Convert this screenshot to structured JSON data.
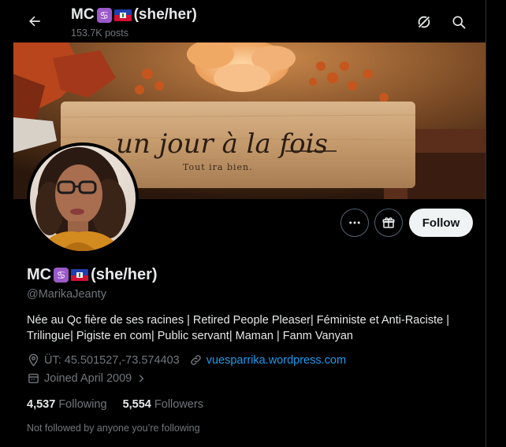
{
  "header": {
    "name": "MC",
    "pronouns": "(she/her)",
    "posts_count": "153.7K posts"
  },
  "profile": {
    "name": "MC",
    "pronouns": "(she/her)",
    "zodiac_emoji": "♋",
    "flag_emoji": "haiti-flag",
    "handle": "@MarikaJeanty",
    "bio": "Née au Qc fière de ses racines | Retired People Pleaser| Féministe et Anti-Raciste | Trilingue| Pigiste en com| Public servant| Maman | Fanm Vanyan",
    "location": "ÜT: 45.501527,-73.574403",
    "website": "vuesparrika.wordpress.com",
    "joined": "Joined April 2009",
    "following_count": "4,537",
    "following_label": "Following",
    "followers_count": "5,554",
    "followers_label": "Followers",
    "not_followed_text": "Not followed by anyone you’re following"
  },
  "banner": {
    "script_text": "un jour à la fois",
    "small_text": "Tout ira bien."
  },
  "buttons": {
    "follow_label": "Follow"
  },
  "icons": {
    "back": "arrow-left-icon",
    "grok": "grok-icon",
    "search": "search-icon",
    "more": "more-dots-icon",
    "subscribe": "gift-icon",
    "location": "location-pin-icon",
    "link": "link-icon",
    "calendar": "calendar-icon",
    "chevron": "chevron-right-icon"
  },
  "colors": {
    "background": "#000000",
    "text_primary": "#e7e9ea",
    "text_secondary": "#71767b",
    "link": "#1d9bf0",
    "follow_button_bg": "#eff3f4"
  }
}
